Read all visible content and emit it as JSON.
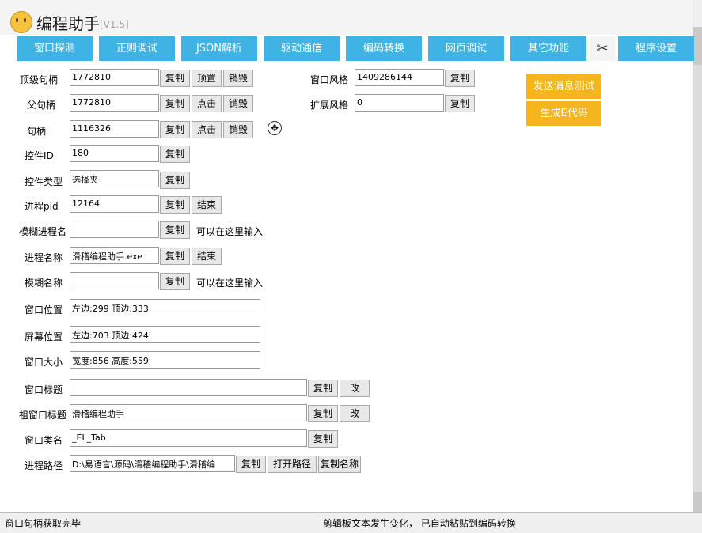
{
  "window": {
    "title": "编程助手",
    "version": "[V1.5]"
  },
  "tabs": [
    "窗口探测",
    "正则调试",
    "JSON解析",
    "驱动通信",
    "编码转换",
    "网页调试",
    "其它功能",
    "程序设置"
  ],
  "scissors_glyph": "✂",
  "left_fields": {
    "top_handle": {
      "label": "顶级句柄",
      "value": "1772810",
      "buttons": [
        "复制",
        "顶置",
        "销毁"
      ]
    },
    "parent_handle": {
      "label": "父句柄",
      "value": "1772810",
      "buttons": [
        "复制",
        "点击",
        "销毁"
      ]
    },
    "handle": {
      "label": "句柄",
      "value": "1116326",
      "buttons": [
        "复制",
        "点击",
        "销毁"
      ]
    },
    "control_id": {
      "label": "控件ID",
      "value": "180",
      "buttons": [
        "复制"
      ]
    },
    "control_type": {
      "label": "控件类型",
      "value": "选择夹",
      "buttons": [
        "复制"
      ]
    },
    "process_pid": {
      "label": "进程pid",
      "value": "12164",
      "buttons": [
        "复制",
        "结束"
      ]
    },
    "fuzzy_process_name": {
      "label": "模糊进程名",
      "value": "",
      "buttons": [
        "复制"
      ],
      "hint": "可以在这里输入"
    },
    "process_name": {
      "label": "进程名称",
      "value": "滑稽编程助手.exe",
      "buttons": [
        "复制",
        "结束"
      ]
    },
    "fuzzy_name": {
      "label": "模糊名称",
      "value": "",
      "buttons": [
        "复制"
      ],
      "hint": "可以在这里输入"
    },
    "window_position": {
      "label": "窗口位置",
      "value": "左边:299 顶边:333"
    },
    "screen_position": {
      "label": "屏幕位置",
      "value": "左边:703 顶边:424"
    },
    "window_size": {
      "label": "窗口大小",
      "value": "宽度:856 高度:559"
    },
    "window_title": {
      "label": "窗口标题",
      "value": "",
      "buttons": [
        "复制",
        "改"
      ]
    },
    "root_window_title": {
      "label": "祖窗口标题",
      "value": "滑稽编程助手",
      "buttons": [
        "复制",
        "改"
      ]
    },
    "window_class": {
      "label": "窗口类名",
      "value": "_EL_Tab",
      "buttons": [
        "复制"
      ]
    },
    "process_path": {
      "label": "进程路径",
      "value": "D:\\易语言\\源码\\滑稽编程助手\\滑稽编",
      "buttons": [
        "复制",
        "打开路径",
        "复制名称"
      ]
    }
  },
  "right_fields": {
    "window_style": {
      "label": "窗口风格",
      "value": "1409286144",
      "button": "复制"
    },
    "ext_style": {
      "label": "扩展风格",
      "value": "0",
      "button": "复制"
    }
  },
  "actions": {
    "send_message_test": "发送消息测试",
    "gen_e_code": "生成E代码"
  },
  "status": {
    "left": "窗口句柄获取完毕",
    "right": "剪辑板文本发生变化， 已自动粘贴到编码转换"
  },
  "colors": {
    "tab_blue": "#3fb3e3",
    "action_orange": "#f5b51e"
  }
}
